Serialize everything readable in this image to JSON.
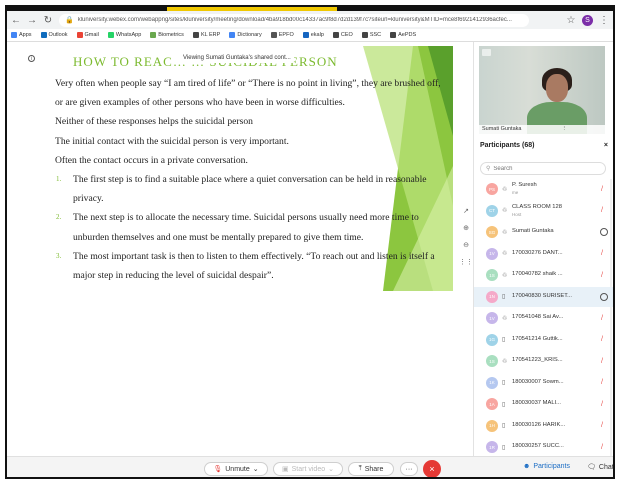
{
  "browser": {
    "url": "kluniversity.webex.com/webappng/sites/kluniversity/meeting/download/4ba918bd00c14337ac9f8d7d2d139f7c?siteurl=kluniversity&MTID=mce8f6921412936acfec...",
    "profile_initial": "S"
  },
  "bookmarks": [
    {
      "label": "Apps",
      "color": "#4285f4"
    },
    {
      "label": "Outlook",
      "color": "#0f6cbd"
    },
    {
      "label": "Gmail",
      "color": "#ea4335"
    },
    {
      "label": "WhatsApp",
      "color": "#25d366"
    },
    {
      "label": "Biometrics",
      "color": "#6aa84f"
    },
    {
      "label": "KL ERP",
      "color": "#444444"
    },
    {
      "label": "Dictionary",
      "color": "#4285f4"
    },
    {
      "label": "EPFO",
      "color": "#555555"
    },
    {
      "label": "ekalp",
      "color": "#1565c0"
    },
    {
      "label": "CEO",
      "color": "#444444"
    },
    {
      "label": "SSC",
      "color": "#444444"
    },
    {
      "label": "AePDS",
      "color": "#444444"
    }
  ],
  "slide": {
    "title": "HOW   TO   REAC…   … SUICIDAL   PERSON",
    "share_tip": "Viewing Sumati Guntaka's shared cont...",
    "paragraphs": [
      "Very often when people say “I am tired of life” or “There is no point in living”, they are brushed off, or are given examples of other persons who have been in worse difficulties.",
      "Neither of these responses helps the suicidal person",
      "The initial contact with the suicidal person is very important.",
      "Often the contact occurs in a private conversation."
    ],
    "steps": [
      {
        "num": "1.",
        "text": "The first step is to find a suitable place where a quiet conversation can be held in reasonable privacy."
      },
      {
        "num": "2.",
        "text": "The next step is to allocate the necessary time. Suicidal persons usually need more time to unburden themselves and one must be mentally prepared to give them time."
      },
      {
        "num": "3.",
        "text": "The most important task is then to listen to them effectively. “To reach out and listen is itself a major step in reducing the level of suicidal despair”."
      }
    ]
  },
  "video": {
    "name": "Sumati Guntaka"
  },
  "participants": {
    "header": "Participants (68)",
    "search_placeholder": "Search",
    "list": [
      {
        "initials": "PS",
        "color": "#f8a5a0",
        "name": "P. Suresh",
        "role": "me",
        "action": "mic"
      },
      {
        "initials": "CT",
        "color": "#9fd3e8",
        "name": "CLASS ROOM 128",
        "role": "Host",
        "action": "mic"
      },
      {
        "initials": "SG",
        "color": "#f6c37a",
        "name": "Sumati Guntaka",
        "role": "",
        "action": "chat"
      },
      {
        "initials": "1V",
        "color": "#c6b6ea",
        "name": "170030276 DANT...",
        "role": "",
        "action": "mic"
      },
      {
        "initials": "1S",
        "color": "#a9dfc0",
        "name": "170040782 shaik ...",
        "role": "",
        "action": "mic"
      },
      {
        "initials": "1N",
        "color": "#f5a9c9",
        "name": "170040830 SURISET...",
        "role": "",
        "action": "chat",
        "selected": true
      },
      {
        "initials": "1V",
        "color": "#c6b6ea",
        "name": "170541048 Sai Av...",
        "role": "",
        "action": "mic"
      },
      {
        "initials": "1G",
        "color": "#9fd3e8",
        "name": "170541214 Guttik...",
        "role": "",
        "action": "mic"
      },
      {
        "initials": "1S",
        "color": "#a9dfc0",
        "name": "170541223_KRIS...",
        "role": "",
        "action": "mic"
      },
      {
        "initials": "1K",
        "color": "#b5c8f0",
        "name": "180030007 Sowm...",
        "role": "",
        "action": "mic"
      },
      {
        "initials": "1A",
        "color": "#f8a5a0",
        "name": "180030037 MALI...",
        "role": "",
        "action": "mic"
      },
      {
        "initials": "1H",
        "color": "#f6c37a",
        "name": "180030126 HARIK...",
        "role": "",
        "action": "mic"
      },
      {
        "initials": "1R",
        "color": "#c6b6ea",
        "name": "180030257 SUCC...",
        "role": "",
        "action": "mic"
      }
    ]
  },
  "controls": {
    "unmute": "Unmute",
    "start_video": "Start video",
    "share": "Share",
    "more": "···",
    "participants": "Participants",
    "chat": "Chat"
  }
}
